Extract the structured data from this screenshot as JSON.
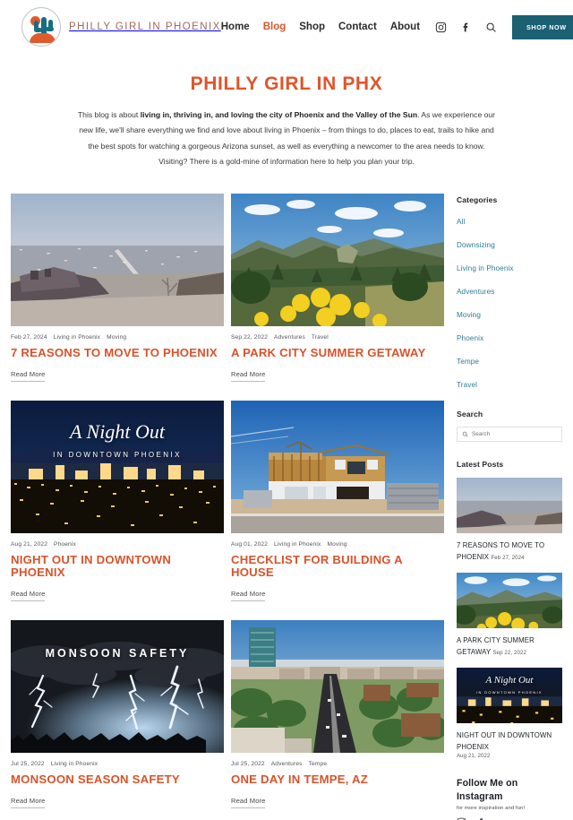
{
  "header": {
    "brand_name": "PHILLY GIRL IN PHOENIX",
    "logo_icon": "cactus-sun-badge-icon",
    "nav": [
      {
        "label": "Home",
        "active": false
      },
      {
        "label": "Blog",
        "active": true
      },
      {
        "label": "Shop",
        "active": false
      },
      {
        "label": "Contact",
        "active": false
      },
      {
        "label": "About",
        "active": false
      }
    ],
    "icons": [
      "instagram-icon",
      "facebook-icon",
      "search-icon"
    ],
    "shop_button": "SHOP NOW",
    "accent_color": "#e0552a",
    "teal_color": "#1b6073"
  },
  "hero": {
    "title": "PHILLY GIRL IN PHX",
    "text_part1": "This blog is about ",
    "text_bold": "living in, thriving in, and loving the city of Phoenix and the Valley of the Sun",
    "text_part2": ". As we experience our new life, we'll share everything we find and love about living in Phoenix – from things to do, places to eat, trails to hike and the best spots for watching a gorgeous Arizona sunset, as well as everything a newcomer to the area needs to know. Visiting? There is a gold-mine of information here to help you plan your trip."
  },
  "posts": [
    {
      "date": "Feb 27, 2024",
      "tags": [
        "Living in Phoenix",
        "Moving"
      ],
      "title": "7 REASONS TO MOVE TO PHOENIX",
      "read_more": "Read More",
      "image": "phoenix-dusk-overlook-photo"
    },
    {
      "date": "Sep 22, 2022",
      "tags": [
        "Adventures",
        "Travel"
      ],
      "title": "A PARK CITY SUMMER GETAWAY",
      "read_more": "Read More",
      "image": "park-city-mountains-wildflowers-photo"
    },
    {
      "date": "Aug 21, 2022",
      "tags": [
        "Phoenix"
      ],
      "title": "NIGHT OUT IN DOWNTOWN PHOENIX",
      "read_more": "Read More",
      "image": "a-night-out-downtown-phoenix-photo",
      "overlay_script": "A Night Out",
      "overlay_sub": "IN DOWNTOWN PHOENIX"
    },
    {
      "date": "Aug 01, 2022",
      "tags": [
        "Living in Phoenix",
        "Moving"
      ],
      "title": "CHECKLIST FOR BUILDING A HOUSE",
      "read_more": "Read More",
      "image": "house-under-construction-photo"
    },
    {
      "date": "Jul 25, 2022",
      "tags": [
        "Living in Phoenix"
      ],
      "title": "MONSOON SEASON SAFETY",
      "read_more": "Read More",
      "image": "lightning-storm-photo",
      "overlay_label": "MONSOON SAFETY"
    },
    {
      "date": "Jul 25, 2022",
      "tags": [
        "Adventures",
        "Tempe"
      ],
      "title": "ONE DAY IN TEMPE, AZ",
      "read_more": "Read More",
      "image": "tempe-aerial-street-photo"
    }
  ],
  "sidebar": {
    "categories_heading": "Categories",
    "categories": [
      "All",
      "Downsizing",
      "Living in Phoenix",
      "Adventures",
      "Moving",
      "Phoenix",
      "Tempe",
      "Travel"
    ],
    "category_color": "#2d7d92",
    "search_heading": "Search",
    "search_placeholder": "Search",
    "search_value": "",
    "search_icon": "magnifier-icon",
    "latest_heading": "Latest Posts",
    "latest": [
      {
        "title": "7 REASONS TO MOVE TO PHOENIX",
        "date": "Feb 27, 2024",
        "image": "phoenix-dusk-overlook-thumb"
      },
      {
        "title": "A PARK CITY SUMMER GETAWAY",
        "date": "Sep 22, 2022",
        "image": "park-city-mountains-thumb"
      },
      {
        "title": "NIGHT OUT IN DOWNTOWN PHOENIX",
        "date": "Aug 21, 2022",
        "image": "a-night-out-thumb",
        "overlay_script": "A Night Out",
        "overlay_sub": "IN DOWNTOWN PHOENIX"
      }
    ],
    "follow_heading": "Follow Me on Instagram",
    "follow_sub": "for more inspiration and fun!",
    "follow_icons": [
      "instagram-icon",
      "facebook-icon"
    ]
  }
}
